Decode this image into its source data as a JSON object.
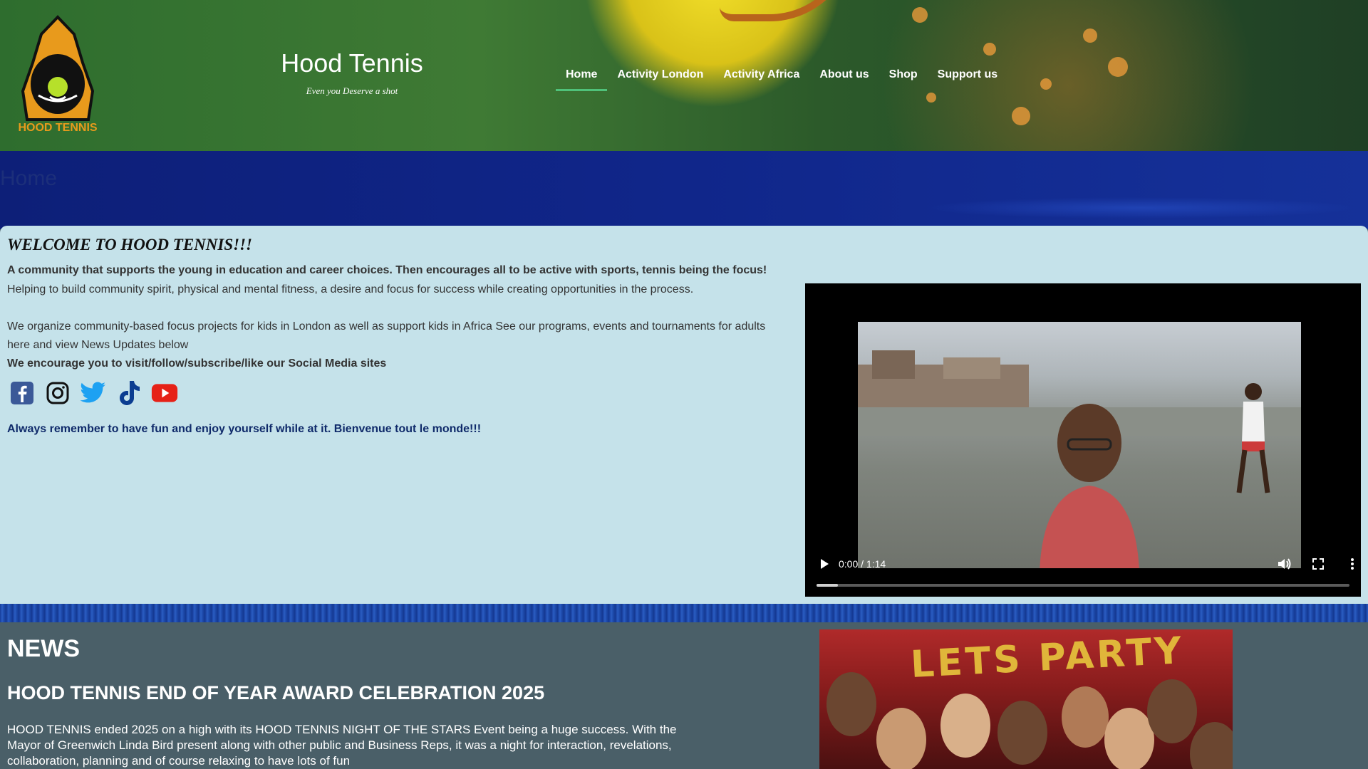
{
  "header": {
    "logo_text": "HOOD TENNIS",
    "title": "Hood Tennis",
    "tagline": "Even you Deserve a shot",
    "nav": [
      {
        "label": "Home",
        "active": true
      },
      {
        "label": "Activity London",
        "active": false
      },
      {
        "label": "Activity Africa",
        "active": false
      },
      {
        "label": "About us",
        "active": false
      },
      {
        "label": "Shop",
        "active": false
      },
      {
        "label": "Support us",
        "active": false
      }
    ],
    "accent_color": "#4fc27a"
  },
  "page": {
    "title": "Home"
  },
  "welcome": {
    "heading": "WELCOME TO HOOD TENNIS!!!",
    "intro_bold": "A community that supports the young in education and career choices. Then encourages all to be active with sports, tennis being the focus!",
    "intro": "Helping to build community spirit, physical and mental fitness, a desire and focus for success while creating opportunities in the process.",
    "programs": "We organize community-based focus projects for kids in London as well as support kids in Africa See our programs, events and tournaments for adults here and view News Updates below",
    "social_prompt": "We encourage you to visit/follow/subscribe/like our Social Media sites",
    "socials": [
      {
        "name": "facebook-icon",
        "color": "#3b5998"
      },
      {
        "name": "instagram-icon",
        "color": "#111111"
      },
      {
        "name": "twitter-icon",
        "color": "#1da1f2"
      },
      {
        "name": "tiktok-icon",
        "color": "#0b3d91"
      },
      {
        "name": "youtube-icon",
        "color": "#e62117"
      }
    ],
    "closing": "Always remember to have fun and enjoy yourself while at it. Bienvenue tout le monde!!!"
  },
  "video": {
    "time": "0:00 / 1:14",
    "progress_buffered": 0.04
  },
  "news": {
    "heading": "NEWS",
    "item_title": "HOOD TENNIS END OF YEAR AWARD CELEBRATION 2025",
    "item_body": "HOOD TENNIS ended 2025 on a high with its HOOD TENNIS NIGHT OF THE STARS Event being a huge success. With the Mayor of Greenwich Linda Bird present along with other public and Business Reps, it was a night for interaction, revelations, collaboration, planning and of course relaxing to have lots of fun",
    "image_banner_text": "LETS PARTY"
  }
}
